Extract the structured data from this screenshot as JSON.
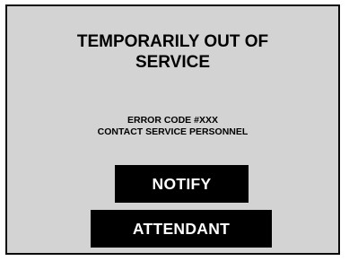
{
  "screen": {
    "title_line1": "TEMPORARILY OUT OF",
    "title_line2": "SERVICE",
    "error_code": "ERROR CODE #XXX",
    "contact_message": "CONTACT SERVICE PERSONNEL",
    "notify_label": "NOTIFY",
    "attendant_label": "ATTENDANT"
  },
  "colors": {
    "panel_background": "#d3d3d3",
    "button_background": "#000000",
    "button_text": "#ffffff",
    "text": "#000000"
  }
}
